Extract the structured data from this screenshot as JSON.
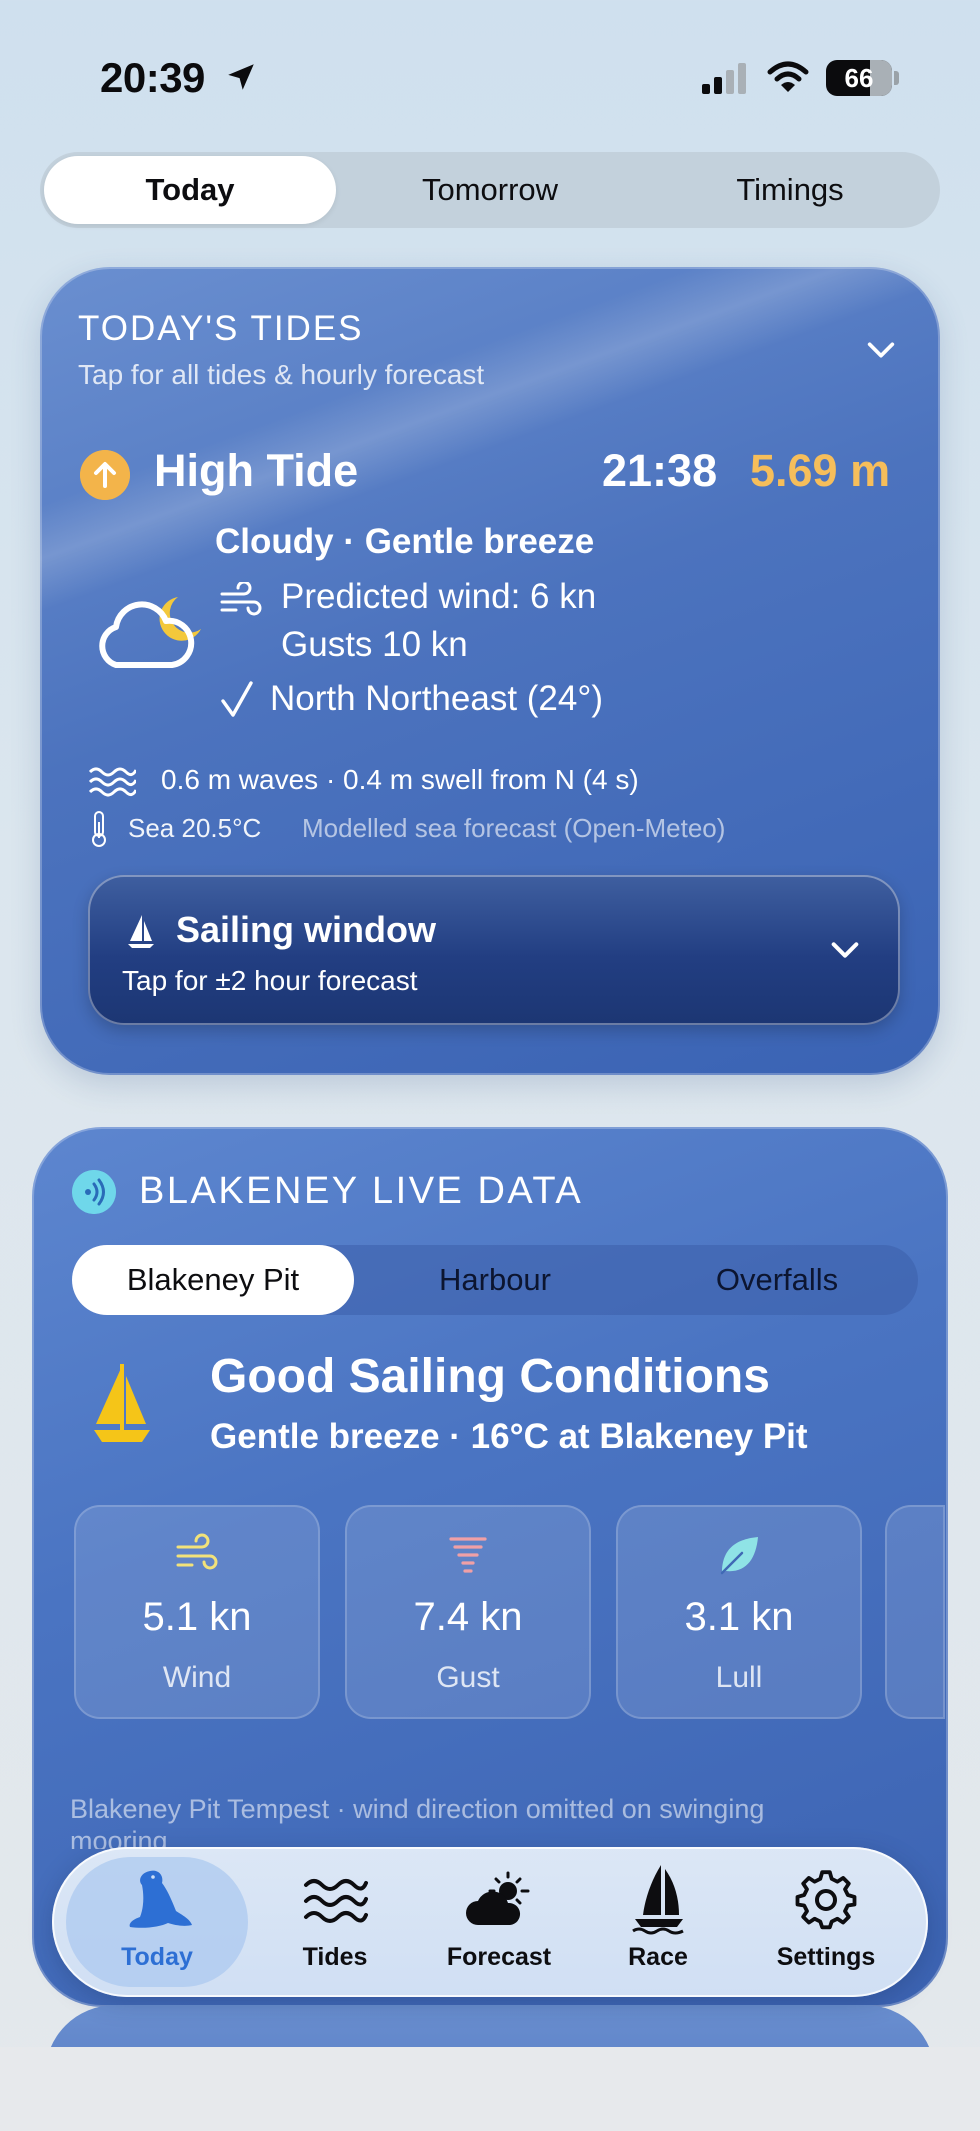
{
  "status_bar": {
    "time": "20:39",
    "battery": "66",
    "battery_level_percent": 66
  },
  "top_tabs": {
    "items": [
      "Today",
      "Tomorrow",
      "Timings"
    ],
    "selected": "Today"
  },
  "tides": {
    "title": "TODAY'S TIDES",
    "subtitle": "Tap for all tides & hourly forecast",
    "tide_label": "High Tide",
    "tide_time": "21:38",
    "tide_height": "5.69 m",
    "conditions": "Cloudy · Gentle breeze",
    "predicted_wind": "Predicted wind: 6 kn",
    "gusts": "Gusts 10 kn",
    "direction": "North Northeast (24°)",
    "waves": "0.6 m waves · 0.4 m swell from N (4 s)",
    "sea_temp": "Sea 20.5°C",
    "source": "Modelled sea forecast (Open-Meteo)",
    "sailing_window": {
      "title": "Sailing window",
      "subtitle": "Tap for ±2 hour forecast"
    }
  },
  "live": {
    "title": "BLAKENEY LIVE DATA",
    "locations": [
      "Blakeney Pit",
      "Harbour",
      "Overfalls"
    ],
    "selected_location": "Blakeney Pit",
    "status_title": "Good Sailing Conditions",
    "status_subtitle": "Gentle breeze · 16°C at Blakeney Pit",
    "tiles": [
      {
        "value": "5.1 kn",
        "label": "Wind",
        "icon": "wind-icon",
        "color": "#f2e27a"
      },
      {
        "value": "7.4 kn",
        "label": "Gust",
        "icon": "tornado-icon",
        "color": "#f0a0a6"
      },
      {
        "value": "3.1 kn",
        "label": "Lull",
        "icon": "leaf-icon",
        "color": "#8fe3e6"
      }
    ],
    "footer": "Blakeney Pit Tempest · wind direction omitted on swinging mooring"
  },
  "tabbar": {
    "items": [
      {
        "label": "Today",
        "icon": "seal-icon"
      },
      {
        "label": "Tides",
        "icon": "waves-icon"
      },
      {
        "label": "Forecast",
        "icon": "cloud-sun-icon"
      },
      {
        "label": "Race",
        "icon": "sailboat-icon"
      },
      {
        "label": "Settings",
        "icon": "gear-icon"
      }
    ],
    "selected": "Today",
    "accent": "#2d6fd4"
  }
}
